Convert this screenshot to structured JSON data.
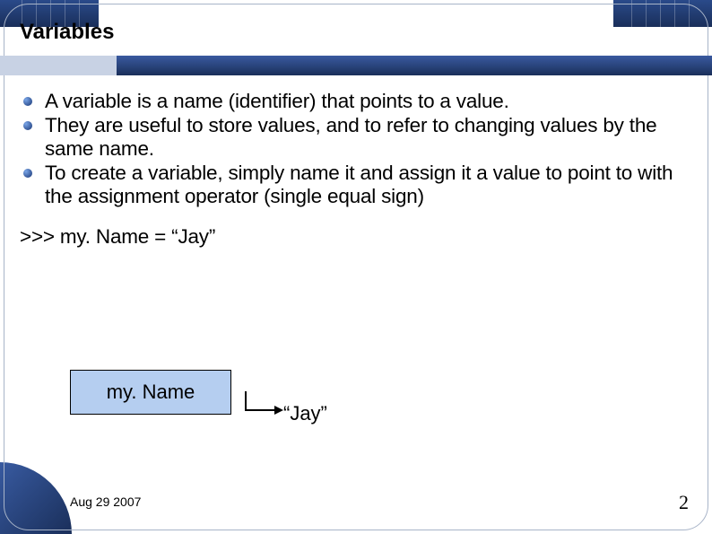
{
  "slide": {
    "title": "Variables",
    "bullets": [
      "A variable is a name (identifier) that points to a value.",
      "They are useful to store values, and to refer to changing values by the same name.",
      "To create a variable, simply name it and assign it a value to point to with the assignment operator (single equal sign)"
    ],
    "code_example": ">>> my. Name = “Jay”",
    "diagram": {
      "variable_label": "my. Name",
      "value_label": "“Jay”"
    },
    "footer_date": "Aug 29 2007",
    "page_number": "2"
  }
}
